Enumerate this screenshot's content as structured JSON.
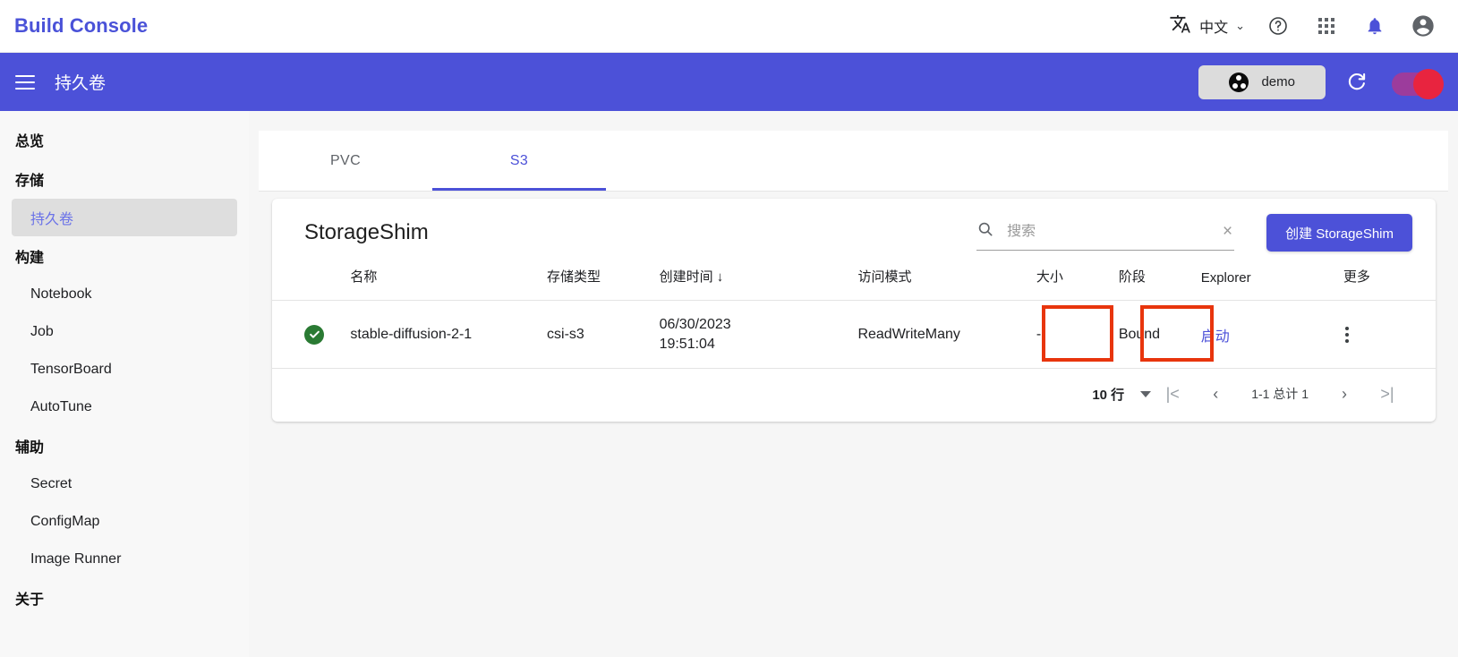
{
  "topbar": {
    "brand": "Build Console",
    "translate_icon": "translate-icon",
    "language": "中文",
    "chevron": "⌄",
    "help_icon": "?",
    "apps_icon": "apps-grid-icon",
    "notifications_icon": "bell-icon",
    "account_icon": "account-circle-icon"
  },
  "toolbar": {
    "menu_icon": "hamburger-menu-icon",
    "title": "持久卷",
    "namespace": "demo",
    "refresh_icon": "↻",
    "toggle_state": "on",
    "toggle_track_color": "#9c3c9c",
    "toggle_thumb_color": "#e8243f",
    "background_color": "#4c51d8"
  },
  "sidebar": {
    "items": [
      {
        "label": "总览",
        "type": "group",
        "active": false
      },
      {
        "label": "存储",
        "type": "group",
        "active": false
      },
      {
        "label": "持久卷",
        "type": "item",
        "active": true
      },
      {
        "label": "构建",
        "type": "group",
        "active": false
      },
      {
        "label": "Notebook",
        "type": "item",
        "active": false
      },
      {
        "label": "Job",
        "type": "item",
        "active": false
      },
      {
        "label": "TensorBoard",
        "type": "item",
        "active": false
      },
      {
        "label": "AutoTune",
        "type": "item",
        "active": false
      },
      {
        "label": "辅助",
        "type": "group",
        "active": false
      },
      {
        "label": "Secret",
        "type": "item",
        "active": false
      },
      {
        "label": "ConfigMap",
        "type": "item",
        "active": false
      },
      {
        "label": "Image Runner",
        "type": "item",
        "active": false
      },
      {
        "label": "关于",
        "type": "group",
        "active": false
      }
    ]
  },
  "tabs": [
    {
      "label": "PVC",
      "active": false
    },
    {
      "label": "S3",
      "active": true
    }
  ],
  "panel": {
    "title": "StorageShim",
    "search": {
      "value": "",
      "placeholder": "搜索",
      "icon": "search-icon",
      "clear_icon": "×"
    },
    "create_button": "创建 StorageShim",
    "accent_color": "#4c51d8"
  },
  "table": {
    "columns": [
      {
        "key": "status",
        "label": ""
      },
      {
        "key": "name",
        "label": "名称"
      },
      {
        "key": "type",
        "label": "存储类型"
      },
      {
        "key": "created",
        "label": "创建时间",
        "sort": "↓"
      },
      {
        "key": "access",
        "label": "访问模式"
      },
      {
        "key": "size",
        "label": "大小"
      },
      {
        "key": "phase",
        "label": "阶段"
      },
      {
        "key": "explorer",
        "label": "Explorer"
      },
      {
        "key": "more",
        "label": "更多"
      }
    ],
    "rows": [
      {
        "status_icon": "check-circle-icon",
        "name": "stable-diffusion-2-1",
        "type": "csi-s3",
        "created_date": "06/30/2023",
        "created_time": "19:51:04",
        "access": "ReadWriteMany",
        "size": "-",
        "phase": "Bound",
        "explorer": "启动",
        "more_icon": "kebab-menu-icon"
      }
    ]
  },
  "pagination": {
    "rows_per_page": "10 行",
    "first_icon": "|<",
    "prev_icon": "‹",
    "range": "1-1 总计 1",
    "next_icon": "›",
    "last_icon": ">|"
  },
  "annotations": {
    "color": "#e8350d",
    "boxes": [
      {
        "target": "phase-cell",
        "label": "Bound"
      },
      {
        "target": "explorer-cell",
        "label": "启动"
      }
    ]
  }
}
